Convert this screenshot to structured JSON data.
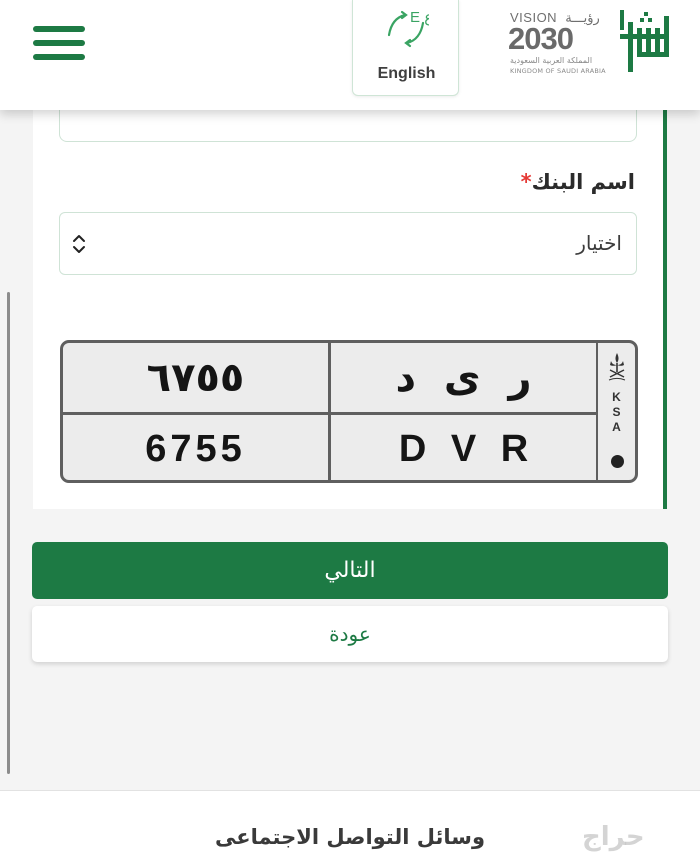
{
  "header": {
    "menu_icon": "hamburger-icon",
    "language": {
      "label": "English",
      "icon": "language-toggle-icon",
      "icon_letters": "E ع"
    },
    "vision_logo": {
      "top_text": "VISION",
      "top_ar": "رؤيـــة",
      "year": "2030",
      "line_ar": "المملكة العربية السعودية",
      "line_en": "KINGDOM OF SAUDI ARABIA"
    },
    "brand_logo": {
      "icon": "absher-logo"
    }
  },
  "form": {
    "bank_label": "اسم البنك",
    "required_mark": "*",
    "bank_select": {
      "value": "اختيار",
      "icon": "up-down-chevron-icon"
    }
  },
  "plate": {
    "numbers_ar": "٦٧٥٥",
    "letters_ar": "ر ى د",
    "numbers_en": "6755",
    "letters_en": "D V R",
    "ksa": [
      "K",
      "S",
      "A"
    ],
    "emblem": "saudi-emblem-icon"
  },
  "actions": {
    "next_label": "التالي",
    "back_label": "عودة"
  },
  "footer": {
    "social_title": "وسائل التواصل الاجتماعى"
  },
  "watermark": {
    "text": "حراج"
  },
  "colors": {
    "brand_green": "#1d7a44",
    "required_red": "#e53935"
  }
}
